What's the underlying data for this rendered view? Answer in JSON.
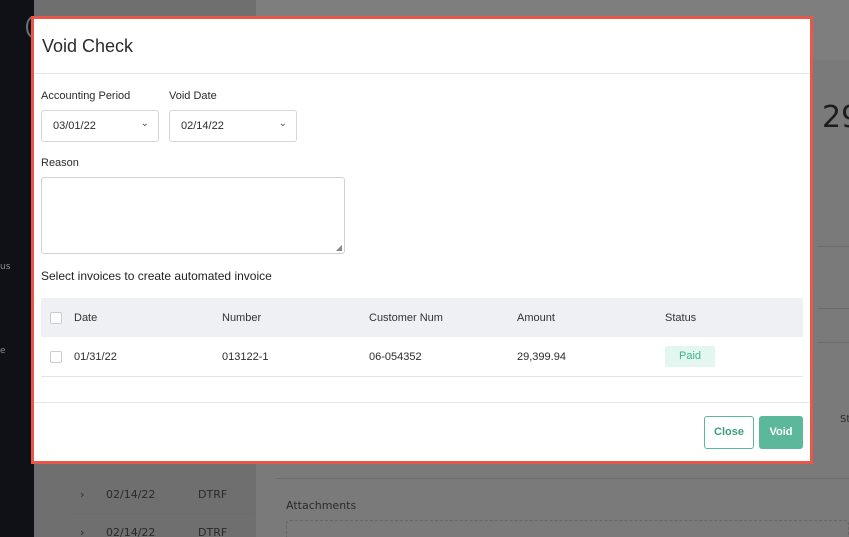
{
  "modal": {
    "title": "Void Check",
    "accounting_period": {
      "label": "Accounting Period",
      "value": "03/01/22"
    },
    "void_date": {
      "label": "Void Date",
      "value": "02/14/22"
    },
    "reason": {
      "label": "Reason",
      "value": ""
    },
    "invoices_title": "Select invoices to create automated invoice",
    "table": {
      "columns": [
        "Date",
        "Number",
        "Customer Num",
        "Amount",
        "Status"
      ],
      "rows": [
        {
          "date": "01/31/22",
          "number": "013122-1",
          "customer_num": "06-054352",
          "amount": "29,399.94",
          "status": "Paid"
        }
      ]
    },
    "buttons": {
      "close": "Close",
      "void": "Void"
    }
  },
  "background": {
    "sidebar_fragments": [
      "us",
      "e"
    ],
    "big_number": "29",
    "status_header": "St",
    "rows": [
      {
        "date": "02/14/22",
        "type": "DTRF"
      },
      {
        "date": "02/14/22",
        "type": "DTRF"
      }
    ],
    "attachments_label": "Attachments"
  },
  "colors": {
    "accent": "#5cb89a",
    "highlight_border": "#e8574a",
    "paid_badge_bg": "#e3f6ef",
    "paid_badge_text": "#3fb38a"
  },
  "icons": {
    "dropdown": "chevron-down-icon",
    "row_expand": "chevron-right-icon",
    "resize": "resize-grip-icon"
  }
}
